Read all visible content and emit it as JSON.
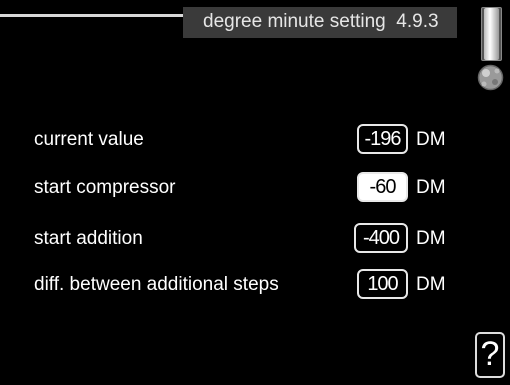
{
  "header": {
    "title": "degree minute setting",
    "menu_number": "4.9.3"
  },
  "icons": {
    "scroll": "scrollbar-icon",
    "knob": "control-knob-icon",
    "help": "help-icon"
  },
  "help_label": "?",
  "rows": [
    {
      "label": "current value",
      "value": "-196",
      "unit": "DM",
      "selected": false
    },
    {
      "label": "start compressor",
      "value": "-60",
      "unit": "DM",
      "selected": true
    },
    {
      "label": "start addition",
      "value": "-400",
      "unit": "DM",
      "selected": false
    },
    {
      "label": "diff. between additional steps",
      "value": "100",
      "unit": "DM",
      "selected": false
    }
  ]
}
